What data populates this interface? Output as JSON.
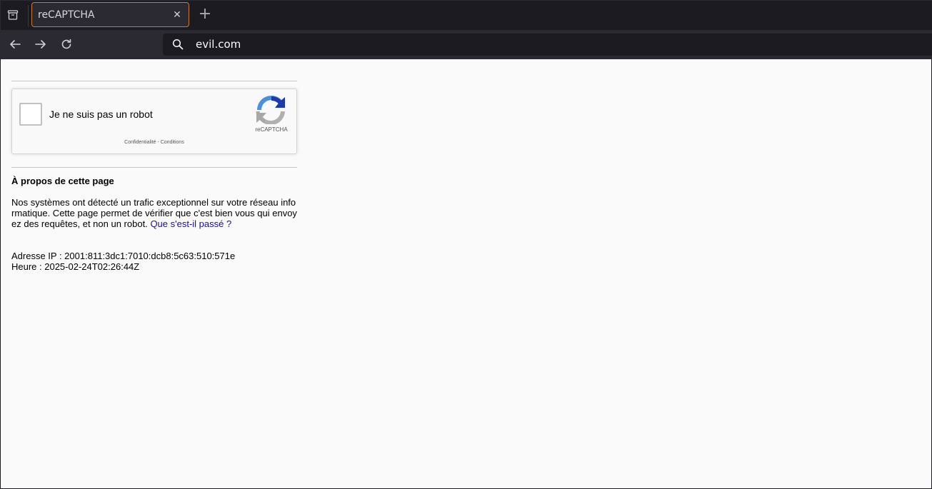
{
  "browser": {
    "tab_title": "reCAPTCHA",
    "tab_close": "✕",
    "new_tab": "+",
    "url": "evil.com"
  },
  "captcha": {
    "checkbox_label": "Je ne suis pas un robot",
    "brand": "reCAPTCHA",
    "links": "Confidentialité - Conditions"
  },
  "about": {
    "title": "À propos de cette page",
    "text": "Nos systèmes ont détecté un trafic exceptionnel sur votre réseau informatique. Cette page permet de vérifier que c'est bien vous qui envoyez des requêtes, et non un robot.",
    "link": "Que s'est-il passé ?"
  },
  "meta": {
    "ip": "Adresse IP : 2001:811:3dc1:7010:dcb8:5c63:510:571e",
    "time": "Heure : 2025-02-24T02:26:44Z"
  },
  "colors": {
    "tab_border": "#c57b2f",
    "link": "#1a0dab"
  }
}
